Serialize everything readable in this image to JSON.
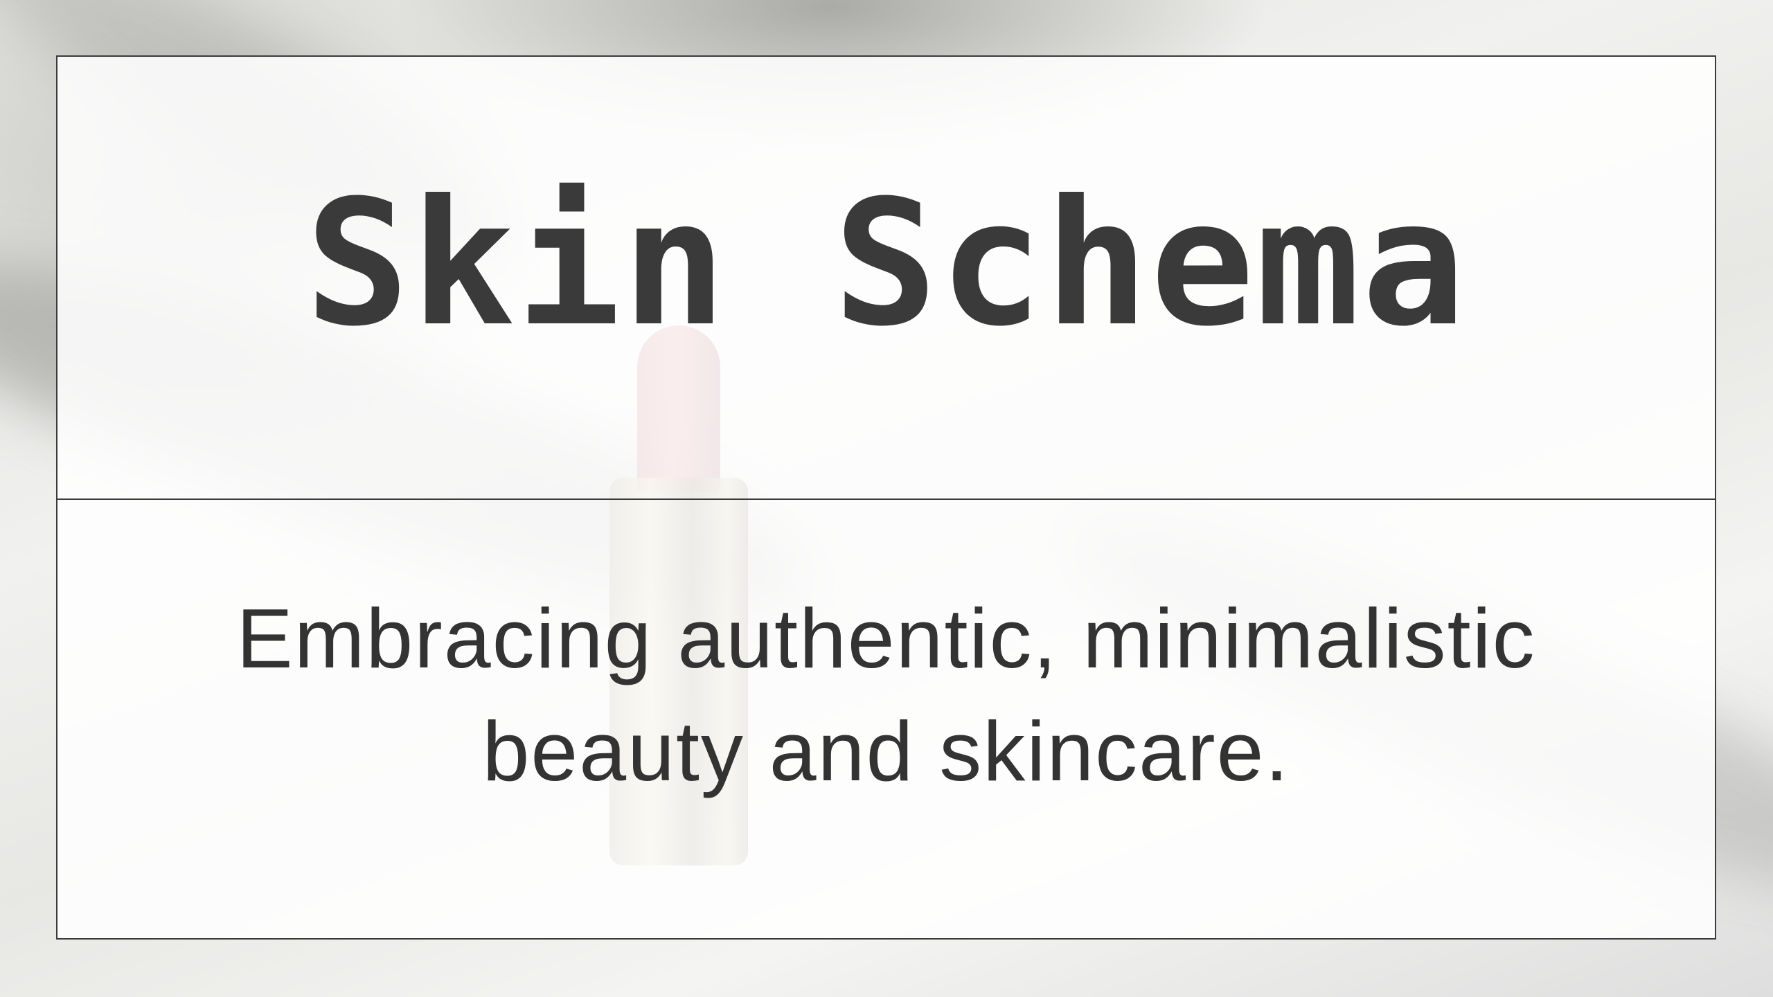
{
  "brand": {
    "name": "Skin Schema"
  },
  "tagline": {
    "text": "Embracing authentic, minimalistic beauty and skincare."
  },
  "colors": {
    "text": "#333333",
    "border": "#3a3a3a",
    "card_background": "#ffffff"
  }
}
